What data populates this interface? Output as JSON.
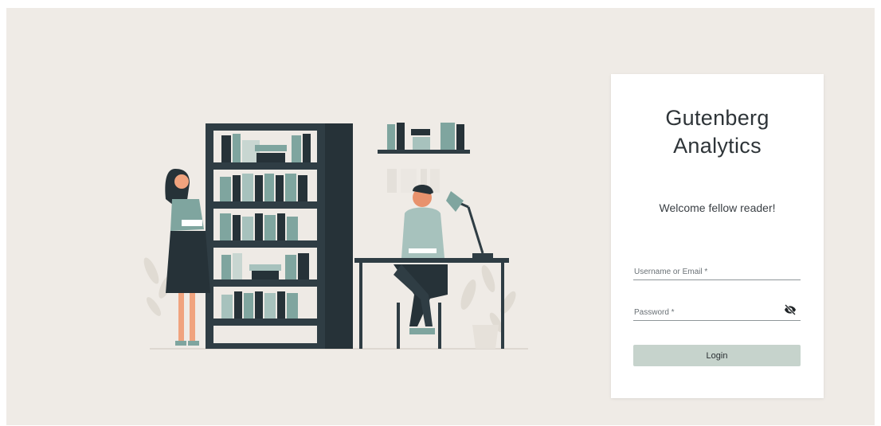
{
  "app": {
    "title": "Gutenberg\nAnalytics",
    "welcome": "Welcome fellow reader!"
  },
  "form": {
    "username_label": "Username or Email *",
    "password_label": "Password *",
    "login_label": "Login"
  },
  "icons": {
    "password_toggle": "eye-off-icon"
  },
  "colors": {
    "background": "#efebe6",
    "accent": "#c6d3cc",
    "shelf": "#2f3d44",
    "book_teal": "#7fa59f"
  }
}
